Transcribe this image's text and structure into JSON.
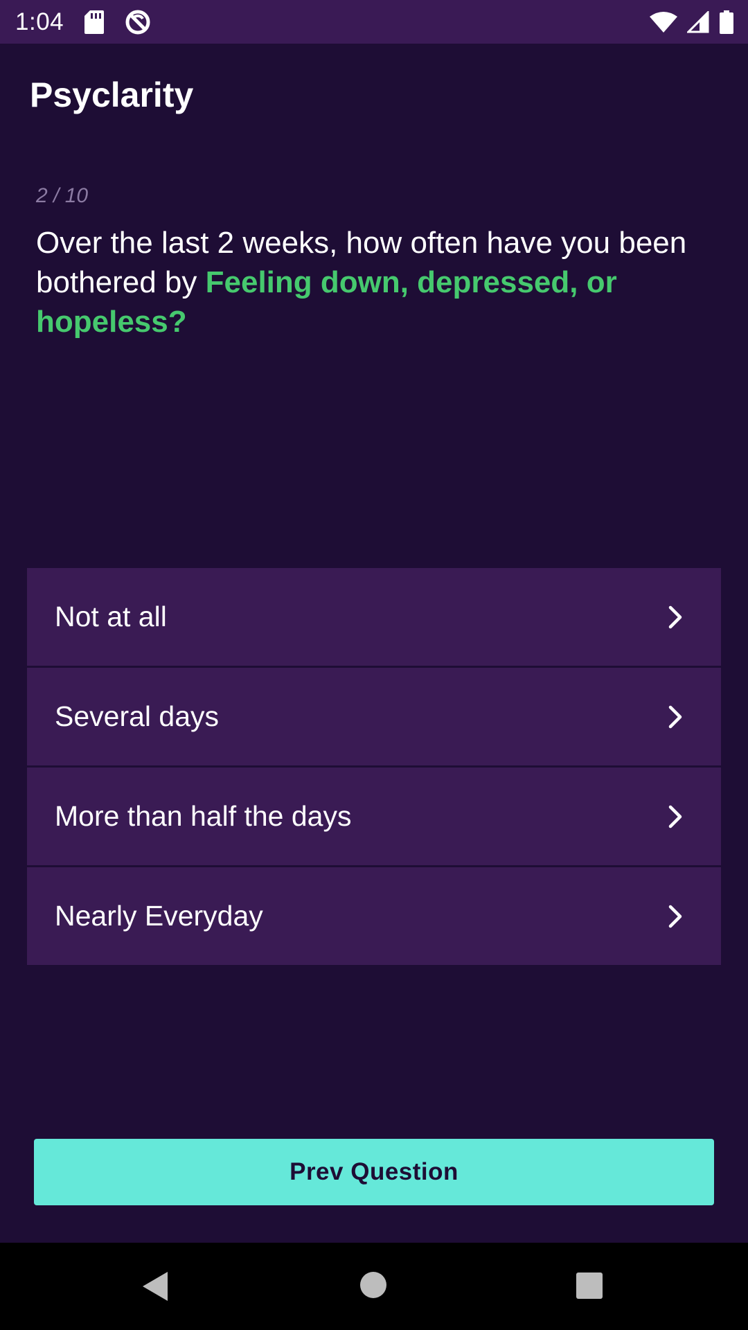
{
  "status_bar": {
    "time": "1:04",
    "icons": [
      "sd-card-icon",
      "no-disturb-icon",
      "wifi-icon",
      "signal-icon",
      "battery-icon"
    ]
  },
  "app": {
    "title": "Psyclarity"
  },
  "question": {
    "counter": "2 / 10",
    "prefix": "Over the last 2 weeks, how often have you been bothered by ",
    "highlight": "Feeling down, depressed, or hopeless?"
  },
  "options": [
    {
      "label": "Not at all"
    },
    {
      "label": "Several days"
    },
    {
      "label": "More than half the days"
    },
    {
      "label": "Nearly Everyday"
    }
  ],
  "actions": {
    "prev_label": "Prev Question"
  },
  "nav": {
    "icons": [
      "back-icon",
      "home-icon",
      "recents-icon"
    ]
  },
  "colors": {
    "background": "#1e0d35",
    "status_bar": "#3a1a55",
    "option_bg": "#3a1b54",
    "highlight": "#46c96e",
    "button": "#65e8d9"
  }
}
